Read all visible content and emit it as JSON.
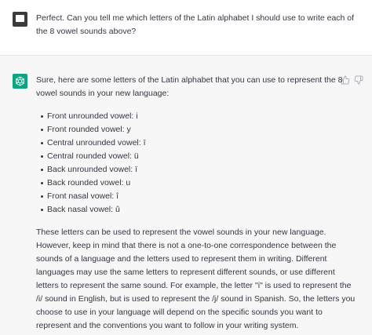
{
  "user_message": {
    "text": "Perfect. Can you tell me which letters of the Latin alphabet I should use to write each of the 8 vowel sounds above?"
  },
  "assistant_message": {
    "intro": "Sure, here are some letters of the Latin alphabet that you can use to represent the 8 vowel sounds in your new language:",
    "items": [
      "Front unrounded vowel: i",
      "Front rounded vowel: y",
      "Central unrounded vowel: ī",
      "Central rounded vowel: ü",
      "Back unrounded vowel: ï",
      "Back rounded vowel: u",
      "Front nasal vowel: î",
      "Back nasal vowel: û"
    ],
    "outro": "These letters can be used to represent the vowel sounds in your new language. However, keep in mind that there is not a one-to-one correspondence between the sounds of a language and the letters used to represent them in writing. Different languages may use the same letters to represent different sounds, or use different letters to represent the same sound. For example, the letter \"i\" is used to represent the /i/ sound in English, but is used to represent the /j/ sound in Spanish. So, the letters you choose to use in your language will depend on the specific sounds you want to represent and the conventions you want to follow in your writing system."
  },
  "icons": {
    "user_avatar": "user-avatar-icon",
    "assistant_avatar": "openai-logo-icon",
    "thumbs_up": "thumbs-up-icon",
    "thumbs_down": "thumbs-down-icon"
  },
  "colors": {
    "assistant_accent": "#10a37f",
    "user_bg": "#ffffff",
    "assistant_bg": "#f7f7f8",
    "text": "#343541"
  }
}
